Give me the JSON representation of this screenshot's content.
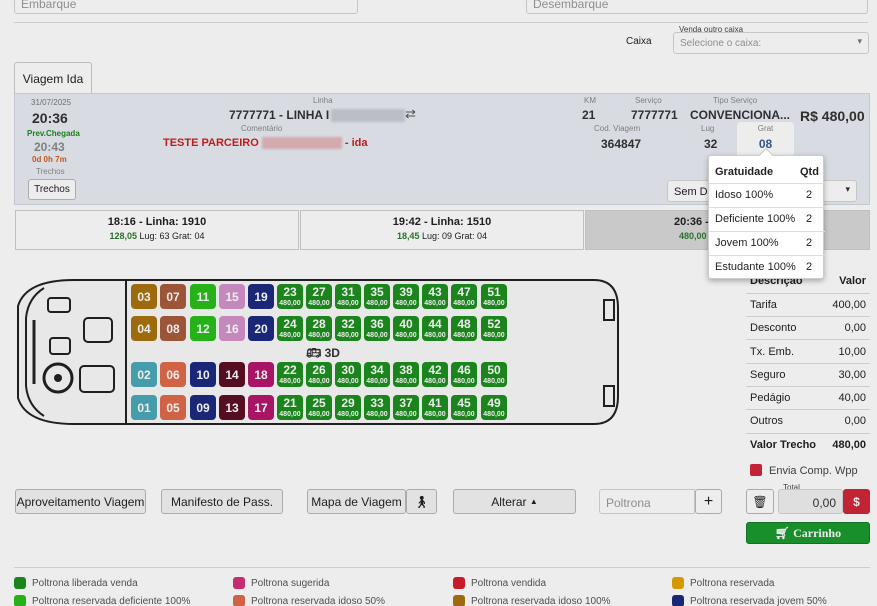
{
  "top": {
    "embarque_placeholder": "Embarque",
    "desembarque_placeholder": "Desembarque"
  },
  "caixa": {
    "label": "Caixa",
    "venda_outro_caixa_label": "Venda outro caixa",
    "select_placeholder": "Selecione o caixa:"
  },
  "tab": {
    "label": "Viagem Ida"
  },
  "trip_info": {
    "date": "31/07/2025",
    "departure": "20:36",
    "prev_chegada_label": "Prev.Chegada",
    "arrival": "20:43",
    "duration": "0d 0h 7m",
    "trechos_label": "Trechos",
    "trechos_button": "Trechos",
    "linha_label": "Linha",
    "linha_value": "7777771 - LINHA I",
    "comentario_label": "Comentário",
    "comentario_prefix": "TESTE PARCEIRO",
    "comentario_suffix": "- ida",
    "km_label": "KM",
    "km_value": "21",
    "servico_label": "Serviço",
    "servico_value": "7777771",
    "tipo_servico_label": "Tipo Serviço",
    "tipo_servico_value": "CONVENCIONA...",
    "price": "R$ 480,00",
    "cod_viagem_label": "Cod. Viagem",
    "cod_viagem_value": "364847",
    "lug_label": "Lug",
    "lug_value": "32",
    "grat_label": "Grat",
    "grat_value": "08",
    "select_partial": "Sem De"
  },
  "gratuidade_popup": {
    "headers": [
      "Gratuidade",
      "Qtd"
    ],
    "rows": [
      {
        "name": "Idoso 100%",
        "qtd": "2"
      },
      {
        "name": "Deficiente 100%",
        "qtd": "2"
      },
      {
        "name": "Jovem 100%",
        "qtd": "2"
      },
      {
        "name": "Estudante 100%",
        "qtd": "2"
      }
    ]
  },
  "trips": [
    {
      "title": "18:16 - Linha: 1910",
      "price": "128,05",
      "info": "Lug: 63 Grat: 04"
    },
    {
      "title": "19:42 - Linha: 1510",
      "price": "18,45",
      "info": "Lug: 09 Grat: 04"
    },
    {
      "title": "20:36 - Linha:",
      "price": "480,00",
      "info": ""
    }
  ],
  "bus": {
    "label_3d": "3D",
    "seat_price": "480,00"
  },
  "seats": [
    {
      "n": "03",
      "color": "#a9740f"
    },
    {
      "n": "07",
      "color": "#a85c3c"
    },
    {
      "n": "11",
      "color": "#2bbf1a"
    },
    {
      "n": "15",
      "color": "#d493cc"
    },
    {
      "n": "19",
      "color": "#1d2a80"
    },
    {
      "n": "23",
      "color": "#1f8f1f",
      "free": true
    },
    {
      "n": "27",
      "color": "#1f8f1f",
      "free": true
    },
    {
      "n": "31",
      "color": "#1f8f1f",
      "free": true
    },
    {
      "n": "35",
      "color": "#1f8f1f",
      "free": true
    },
    {
      "n": "39",
      "color": "#1f8f1f",
      "free": true
    },
    {
      "n": "43",
      "color": "#1f8f1f",
      "free": true
    },
    {
      "n": "47",
      "color": "#1f8f1f",
      "free": true
    },
    {
      "n": "51",
      "color": "#1f8f1f",
      "free": true
    },
    {
      "n": "04",
      "color": "#a9740f"
    },
    {
      "n": "08",
      "color": "#a85c3c"
    },
    {
      "n": "12",
      "color": "#2bbf1a"
    },
    {
      "n": "16",
      "color": "#d493cc"
    },
    {
      "n": "20",
      "color": "#1d2a80"
    },
    {
      "n": "24",
      "color": "#1f8f1f",
      "free": true
    },
    {
      "n": "28",
      "color": "#1f8f1f",
      "free": true
    },
    {
      "n": "32",
      "color": "#1f8f1f",
      "free": true
    },
    {
      "n": "36",
      "color": "#1f8f1f",
      "free": true
    },
    {
      "n": "40",
      "color": "#1f8f1f",
      "free": true
    },
    {
      "n": "44",
      "color": "#1f8f1f",
      "free": true
    },
    {
      "n": "48",
      "color": "#1f8f1f",
      "free": true
    },
    {
      "n": "52",
      "color": "#1f8f1f",
      "free": true
    },
    {
      "n": "02",
      "color": "#4ba8b8"
    },
    {
      "n": "06",
      "color": "#e06a4c"
    },
    {
      "n": "10",
      "color": "#1d2a80"
    },
    {
      "n": "14",
      "color": "#5c0f25"
    },
    {
      "n": "18",
      "color": "#b5176d"
    },
    {
      "n": "22",
      "color": "#1f8f1f",
      "free": true
    },
    {
      "n": "26",
      "color": "#1f8f1f",
      "free": true
    },
    {
      "n": "30",
      "color": "#1f8f1f",
      "free": true
    },
    {
      "n": "34",
      "color": "#1f8f1f",
      "free": true
    },
    {
      "n": "38",
      "color": "#1f8f1f",
      "free": true
    },
    {
      "n": "42",
      "color": "#1f8f1f",
      "free": true
    },
    {
      "n": "46",
      "color": "#1f8f1f",
      "free": true
    },
    {
      "n": "50",
      "color": "#1f8f1f",
      "free": true
    },
    {
      "n": "01",
      "color": "#4ba8b8"
    },
    {
      "n": "05",
      "color": "#e06a4c"
    },
    {
      "n": "09",
      "color": "#1d2a80"
    },
    {
      "n": "13",
      "color": "#5c0f25"
    },
    {
      "n": "17",
      "color": "#b5176d"
    },
    {
      "n": "21",
      "color": "#1f8f1f",
      "free": true
    },
    {
      "n": "25",
      "color": "#1f8f1f",
      "free": true
    },
    {
      "n": "29",
      "color": "#1f8f1f",
      "free": true
    },
    {
      "n": "33",
      "color": "#1f8f1f",
      "free": true
    },
    {
      "n": "37",
      "color": "#1f8f1f",
      "free": true
    },
    {
      "n": "41",
      "color": "#1f8f1f",
      "free": true
    },
    {
      "n": "45",
      "color": "#1f8f1f",
      "free": true
    },
    {
      "n": "49",
      "color": "#1f8f1f",
      "free": true
    }
  ],
  "fare": {
    "headers": [
      "Descrição",
      "Valor"
    ],
    "rows": [
      {
        "d": "Tarifa",
        "v": "400,00"
      },
      {
        "d": "Desconto",
        "v": "0,00"
      },
      {
        "d": "Tx. Emb.",
        "v": "10,00"
      },
      {
        "d": "Seguro",
        "v": "30,00"
      },
      {
        "d": "Pedágio",
        "v": "40,00"
      },
      {
        "d": "Outros",
        "v": "0,00"
      }
    ],
    "total_label": "Valor Trecho",
    "total_value": "480,00"
  },
  "envia_label": "Envia Comp. Wpp",
  "buttons": {
    "aproveitamento": "Aproveitamento Viagem",
    "manifesto": "Manifesto de Pass.",
    "mapa": "Mapa de Viagem",
    "alterar": "Alterar",
    "poltrona_placeholder": "Poltrona",
    "carrinho": "Carrinho"
  },
  "total": {
    "label": "Total",
    "value": "0,00"
  },
  "legend": [
    {
      "label": "Poltrona liberada venda",
      "color": "#1f8f1f"
    },
    {
      "label": "Poltrona sugerida",
      "color": "#d4307a"
    },
    {
      "label": "Poltrona vendida",
      "color": "#d81e2c"
    },
    {
      "label": "Poltrona reservada",
      "color": "#e6a500"
    },
    {
      "label": "Poltrona reservada deficiente 100%",
      "color": "#2bbf1a"
    },
    {
      "label": "Poltrona reservada idoso 50%",
      "color": "#e06a4c"
    },
    {
      "label": "Poltrona reservada idoso 100%",
      "color": "#a9740f"
    },
    {
      "label": "Poltrona reservada jovem 50%",
      "color": "#1d2a80"
    }
  ],
  "colors": {
    "accent_green": "#1a9a2e",
    "danger": "#d0283a",
    "header_blue_bg": "#e9edf4"
  }
}
